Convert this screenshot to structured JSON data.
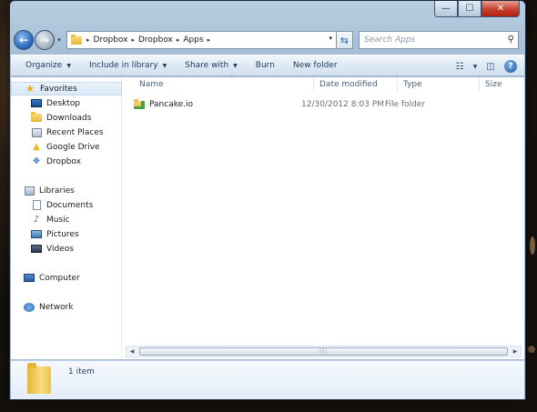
{
  "window": {
    "minimize_symbol": "—",
    "maximize_symbol": "☐",
    "close_symbol": "✕"
  },
  "address_bar": {
    "path": [
      "Dropbox",
      "Dropbox",
      "Apps"
    ],
    "separator": "▸",
    "dropdown_symbol": "▾"
  },
  "nav_buttons": {
    "back_symbol": "←",
    "forward_symbol": "→",
    "history_symbol": "▾"
  },
  "refresh_symbol": "⇆",
  "search": {
    "placeholder": "Search Apps",
    "icon": "search-icon",
    "icon_glyph": "⚲"
  },
  "toolbar": {
    "organize": "Organize",
    "include_in_library": "Include in library",
    "share_with": "Share with",
    "burn": "Burn",
    "new_folder": "New folder",
    "view_glyph": "☷",
    "preview_glyph": "◫",
    "help_glyph": "?",
    "dropdown_arrow": "▼"
  },
  "sidebar": {
    "favorites_label": "Favorites",
    "favorites": [
      "Desktop",
      "Downloads",
      "Recent Places",
      "Google Drive",
      "Dropbox"
    ],
    "libraries_label": "Libraries",
    "libraries": [
      "Documents",
      "Music",
      "Pictures",
      "Videos"
    ],
    "computer_label": "Computer",
    "network_label": "Network"
  },
  "columns": {
    "name": "Name",
    "date_modified": "Date modified",
    "type": "Type",
    "size": "Size",
    "sort_arrow": "^"
  },
  "files": [
    {
      "name": "Pancake.io",
      "date_modified": "12/30/2012 8:03 PM",
      "type": "File folder",
      "icon": "shared-folder-icon"
    }
  ],
  "scrollbar": {
    "left_arrow": "◀",
    "right_arrow": "▶",
    "grip": "|||"
  },
  "details_pane": {
    "item_count": "1 item"
  }
}
